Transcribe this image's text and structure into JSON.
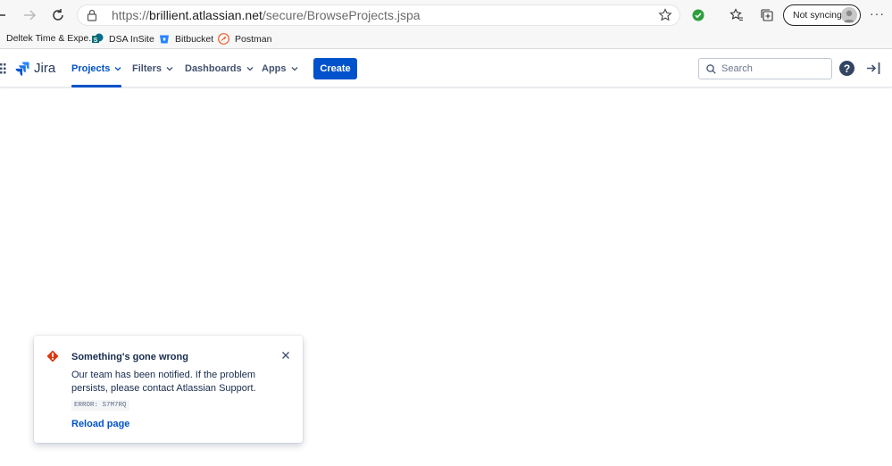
{
  "browser": {
    "url_prefix": "https://",
    "url_host": "brillient.atlassian.net",
    "url_path": "/secure/BrowseProjects.jspa",
    "sync_label": "Not syncing",
    "more_label": "···"
  },
  "bookmarks": [
    {
      "label": "Deltek Time & Expe...",
      "icon": "deltek-icon"
    },
    {
      "label": "DSA InSite",
      "icon": "sharepoint-icon"
    },
    {
      "label": "Bitbucket",
      "icon": "bitbucket-icon"
    },
    {
      "label": "Postman",
      "icon": "postman-icon"
    }
  ],
  "jira": {
    "logo_text": "Jira",
    "menu": [
      {
        "label": "Projects",
        "active": true
      },
      {
        "label": "Filters",
        "active": false
      },
      {
        "label": "Dashboards",
        "active": false
      },
      {
        "label": "Apps",
        "active": false
      }
    ],
    "create_label": "Create",
    "search_placeholder": "Search",
    "help_label": "?"
  },
  "flag": {
    "title": "Something's gone wrong",
    "description": "Our team has been notified. If the problem persists, please contact Atlassian Support.",
    "error_code": "ERROR: S7M7RQ",
    "action_label": "Reload page"
  },
  "colors": {
    "jira_blue": "#0052cc",
    "error_red": "#de350b",
    "text": "#172b4d"
  }
}
